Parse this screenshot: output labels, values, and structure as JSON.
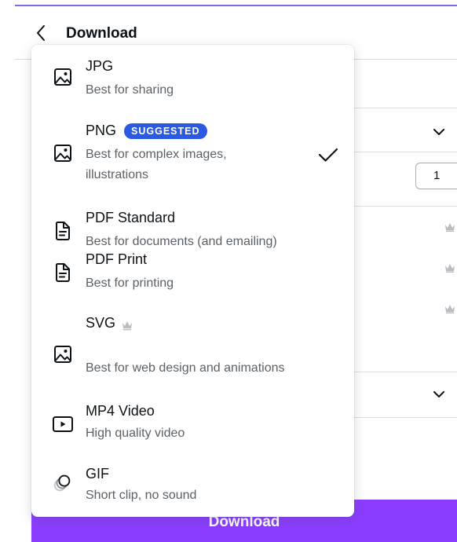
{
  "header": {
    "title": "Download",
    "back_icon": "chevron-left-icon"
  },
  "background": {
    "page_count_value": "1",
    "download_button_label": "Download"
  },
  "options": [
    {
      "title": "JPG",
      "desc": "Best for sharing",
      "icon": "image-icon"
    },
    {
      "title": "PNG",
      "badge": "SUGGESTED",
      "desc_line1": "Best for complex images,",
      "desc_line2": "illustrations",
      "icon": "image-icon",
      "selected": true
    },
    {
      "title": "PDF Standard",
      "desc": "Best for documents (and emailing)",
      "icon": "document-icon"
    },
    {
      "title": "PDF Print",
      "desc": "Best for printing",
      "icon": "document-icon"
    },
    {
      "title": "SVG",
      "desc": "Best for web design and animations",
      "icon": "image-icon",
      "premium": true
    },
    {
      "title": "MP4 Video",
      "desc": "High quality video",
      "icon": "video-icon"
    },
    {
      "title": "GIF",
      "desc": "Short clip, no sound",
      "icon": "gif-icon"
    }
  ],
  "colors": {
    "accent": "#8b3dff",
    "badge": "#2b59e0",
    "top_line": "#7d67ea"
  }
}
